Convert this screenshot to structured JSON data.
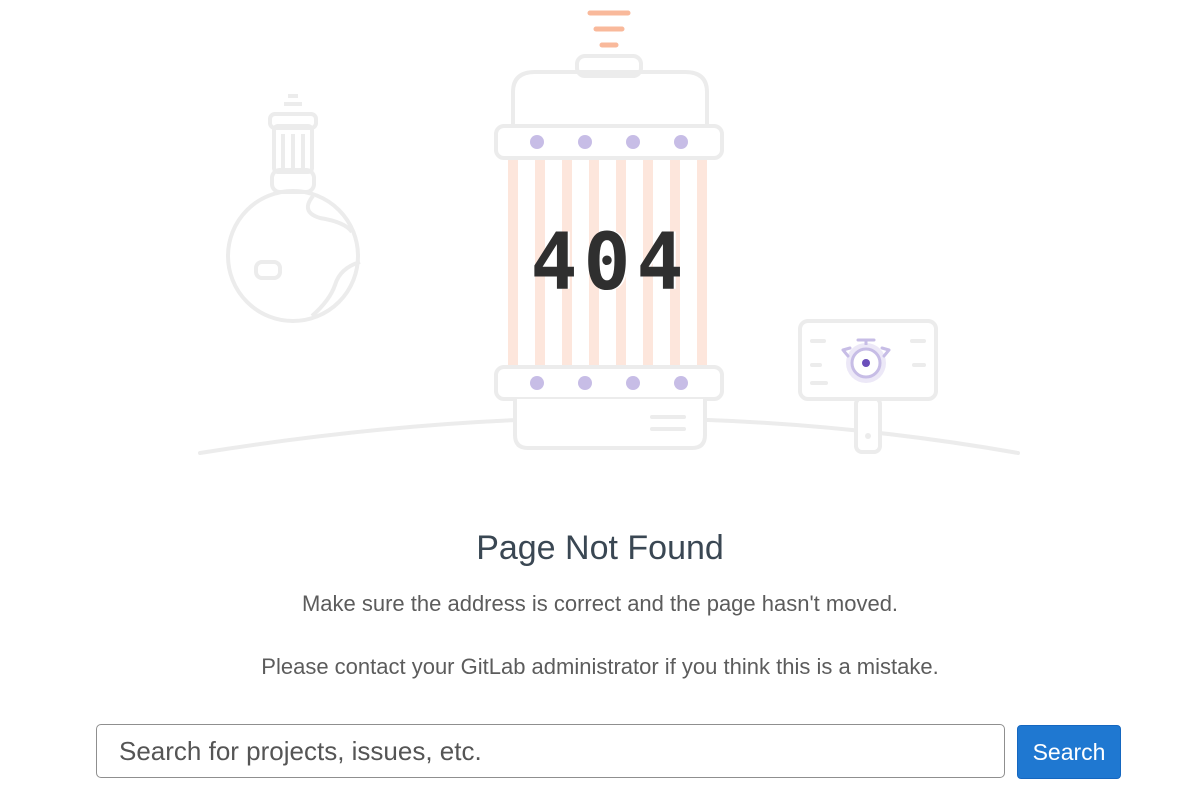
{
  "error": {
    "code": "404",
    "title": "Page Not Found",
    "message": "Make sure the address is correct and the page hasn't moved.",
    "contact": "Please contact your GitLab administrator if you think this is a mistake."
  },
  "search": {
    "placeholder": "Search for projects, issues, etc.",
    "value": "",
    "button_label": "Search"
  },
  "colors": {
    "accent": "#1f78d1",
    "stripe": "#fde6dc",
    "dot": "#c7bde6",
    "outline": "#ececec",
    "beacon": "#f9b99b"
  },
  "icons": {
    "illustration": "404-space-capsule-illustration",
    "planet": "planet-icon",
    "beacon": "antenna-beacon-icon",
    "sign": "signpost-icon",
    "target": "target-icon"
  }
}
